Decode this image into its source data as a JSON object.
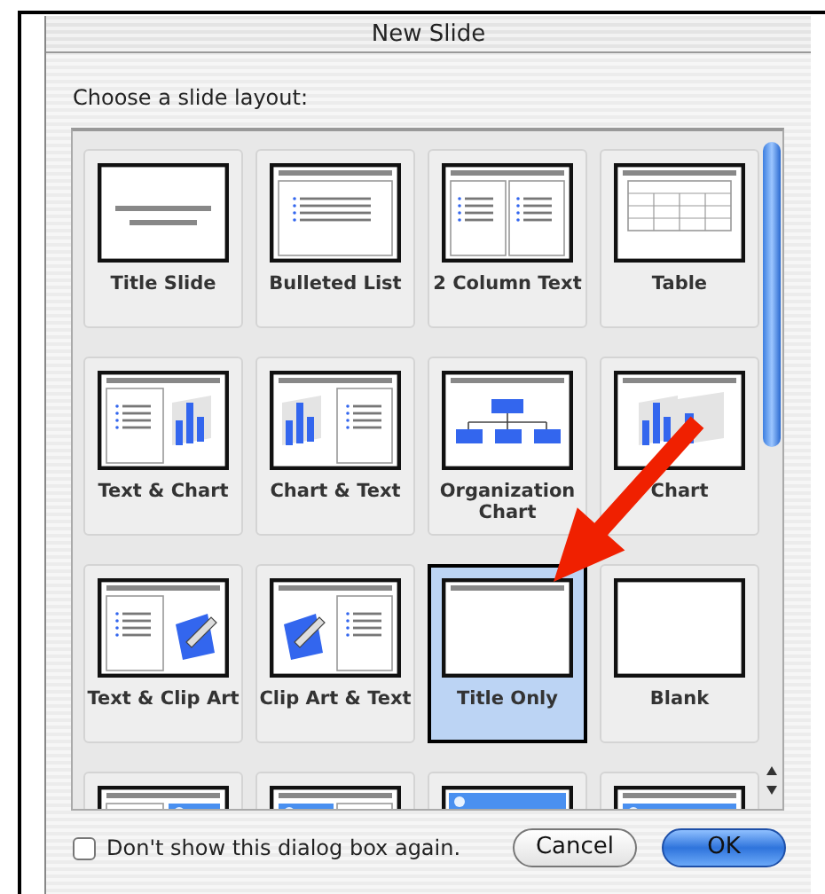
{
  "window": {
    "title": "New Slide"
  },
  "prompt": "Choose a slide layout:",
  "layouts": [
    {
      "kind": "title",
      "label": "Title Slide",
      "selected": false
    },
    {
      "kind": "bulleted",
      "label": "Bulleted List",
      "selected": false
    },
    {
      "kind": "two-column",
      "label": "2 Column Text",
      "selected": false
    },
    {
      "kind": "table",
      "label": "Table",
      "selected": false
    },
    {
      "kind": "text-chart",
      "label": "Text & Chart",
      "selected": false
    },
    {
      "kind": "chart-text",
      "label": "Chart & Text",
      "selected": false
    },
    {
      "kind": "org",
      "label": "Organization Chart",
      "selected": false
    },
    {
      "kind": "chart",
      "label": "Chart",
      "selected": false
    },
    {
      "kind": "text-clipart",
      "label": "Text & Clip Art",
      "selected": false
    },
    {
      "kind": "clipart-text",
      "label": "Clip Art & Text",
      "selected": false
    },
    {
      "kind": "title-only",
      "label": "Title Only",
      "selected": true
    },
    {
      "kind": "blank",
      "label": "Blank",
      "selected": false
    },
    {
      "kind": "text-media",
      "selected": false
    },
    {
      "kind": "media-text",
      "selected": false
    },
    {
      "kind": "media",
      "selected": false
    },
    {
      "kind": "title-media",
      "selected": false
    }
  ],
  "dont_show": {
    "label": "Don't show this dialog box again.",
    "checked": false
  },
  "buttons": [
    {
      "kind": "cancel",
      "label": "Cancel"
    },
    {
      "kind": "default",
      "label": "OK"
    }
  ]
}
